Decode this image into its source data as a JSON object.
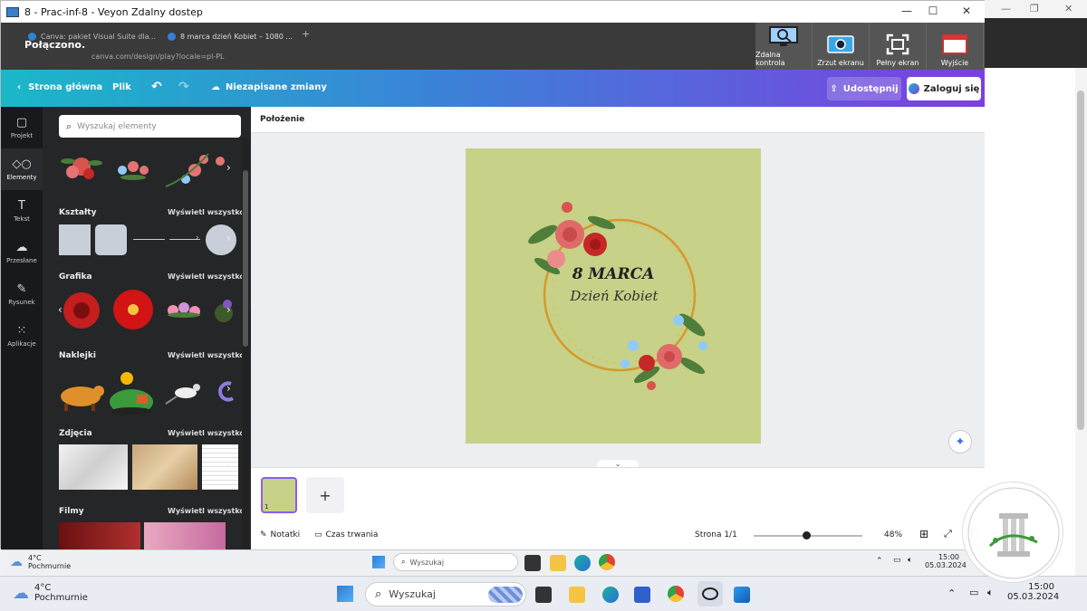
{
  "veyon": {
    "title": "8 - Prac-inf-8 - Veyon Zdalny dostep",
    "status": "Połączono.",
    "tools": [
      {
        "label": "Zdalna kontrola",
        "icon": "monitor-search-icon"
      },
      {
        "label": "Zrzut ekranu",
        "icon": "camera-icon"
      },
      {
        "label": "Pełny ekran",
        "icon": "fullscreen-icon"
      },
      {
        "label": "Wyjście",
        "icon": "exit-icon"
      }
    ]
  },
  "browser": {
    "tabs": [
      "Canva: pakiet Visual Suite dla...",
      "8 marca dzień Kobiet – 1080 ..."
    ],
    "address": "canva.com/design/play?locale=pl-PL"
  },
  "canva": {
    "home": "Strona główna",
    "file": "Plik",
    "unsaved": "Niezapisane zmiany",
    "share": "Udostępnij",
    "login": "Zaloguj się"
  },
  "rail": [
    "Projekt",
    "Elementy",
    "Tekst",
    "Przesłane",
    "Rysunek",
    "Aplikacje"
  ],
  "panel": {
    "search_placeholder": "Wyszukaj elementy",
    "view_all": "Wyświetl wszystko",
    "sections": [
      "Kształty",
      "Grafika",
      "Naklejki",
      "Zdjęcia",
      "Filmy"
    ]
  },
  "editor": {
    "context_label": "Położenie",
    "design_title": "8 MARCA",
    "design_subtitle": "Dzień Kobiet",
    "page_number": "1",
    "notes": "Notatki",
    "duration": "Czas trwania",
    "page_indicator": "Strona 1/1",
    "zoom": "48%",
    "zoom_level": 0.48
  },
  "inner_taskbar": {
    "temp": "4°C",
    "weather": "Pochmurnie",
    "search": "Wyszukaj",
    "time": "15:00",
    "date": "05.03.2024"
  },
  "main_taskbar": {
    "temp": "4°C",
    "weather": "Pochmurnie",
    "search": "Wyszukaj",
    "time": "15:00",
    "date": "05.03.2024"
  },
  "colors": {
    "canva_gradient_start": "#1ab8c8",
    "canva_gradient_end": "#7d3fe0",
    "design_bg": "#c7d188",
    "panel_bg": "#252627"
  }
}
